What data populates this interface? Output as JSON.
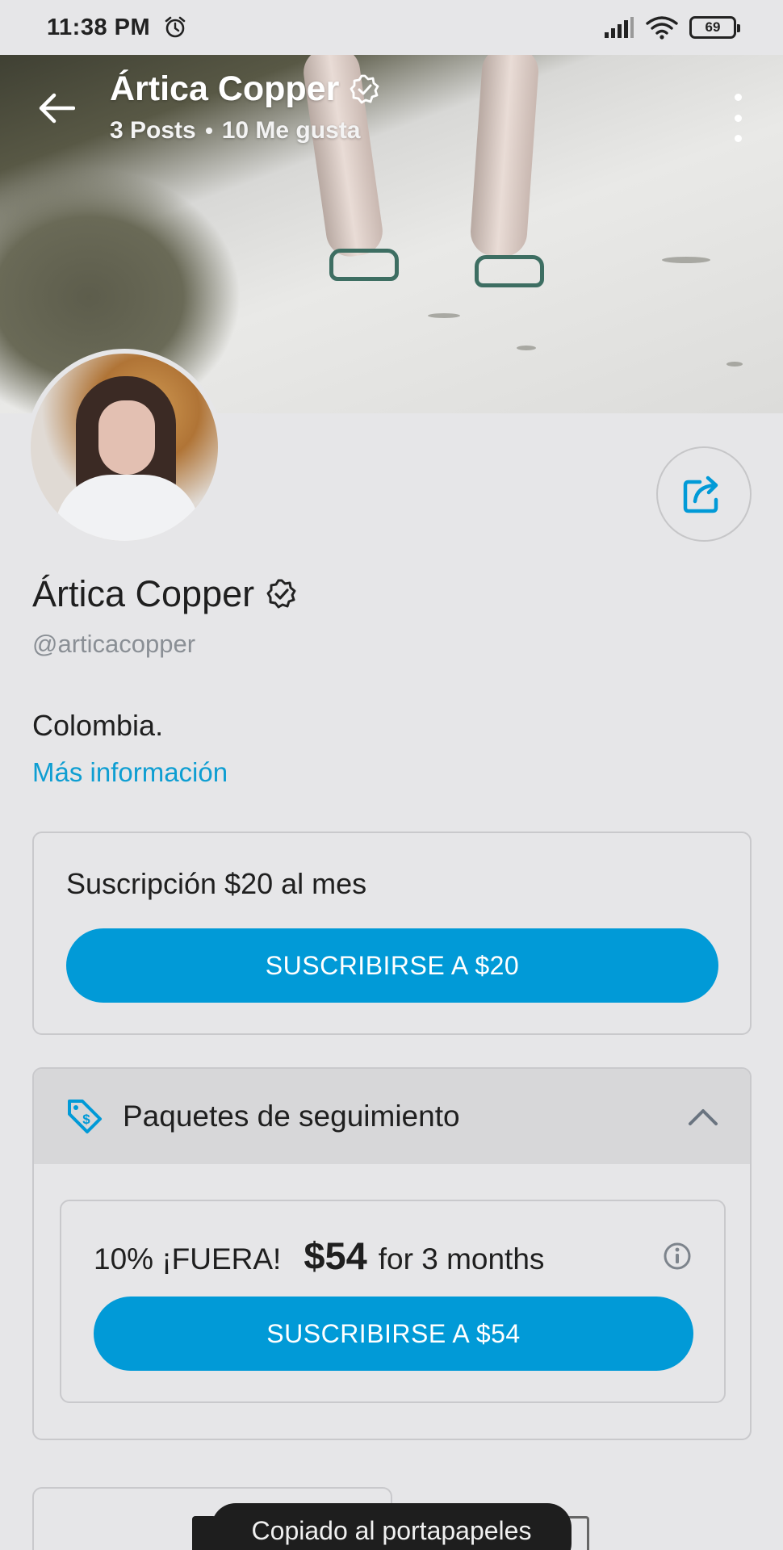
{
  "status_bar": {
    "time": "11:38 PM",
    "battery": "69"
  },
  "header": {
    "name": "Ártica Copper",
    "posts": "3 Posts",
    "likes": "10 Me gusta"
  },
  "profile": {
    "name": "Ártica Copper",
    "handle": "@articacopper",
    "bio": "Colombia.",
    "more_info": "Más información"
  },
  "subscription": {
    "title": "Suscripción $20 al mes",
    "button": "SUSCRIBIRSE A $20"
  },
  "bundles": {
    "title": "Paquetes de seguimiento",
    "offer": {
      "discount": "10% ¡FUERA!",
      "price": "$54",
      "term": "for 3 months",
      "button": "SUSCRIBIRSE A $54"
    }
  },
  "toast": {
    "message": "Copiado al portapapeles"
  },
  "colors": {
    "accent": "#019ad7",
    "link": "#0e9ed2",
    "background": "#e6e6e8"
  }
}
